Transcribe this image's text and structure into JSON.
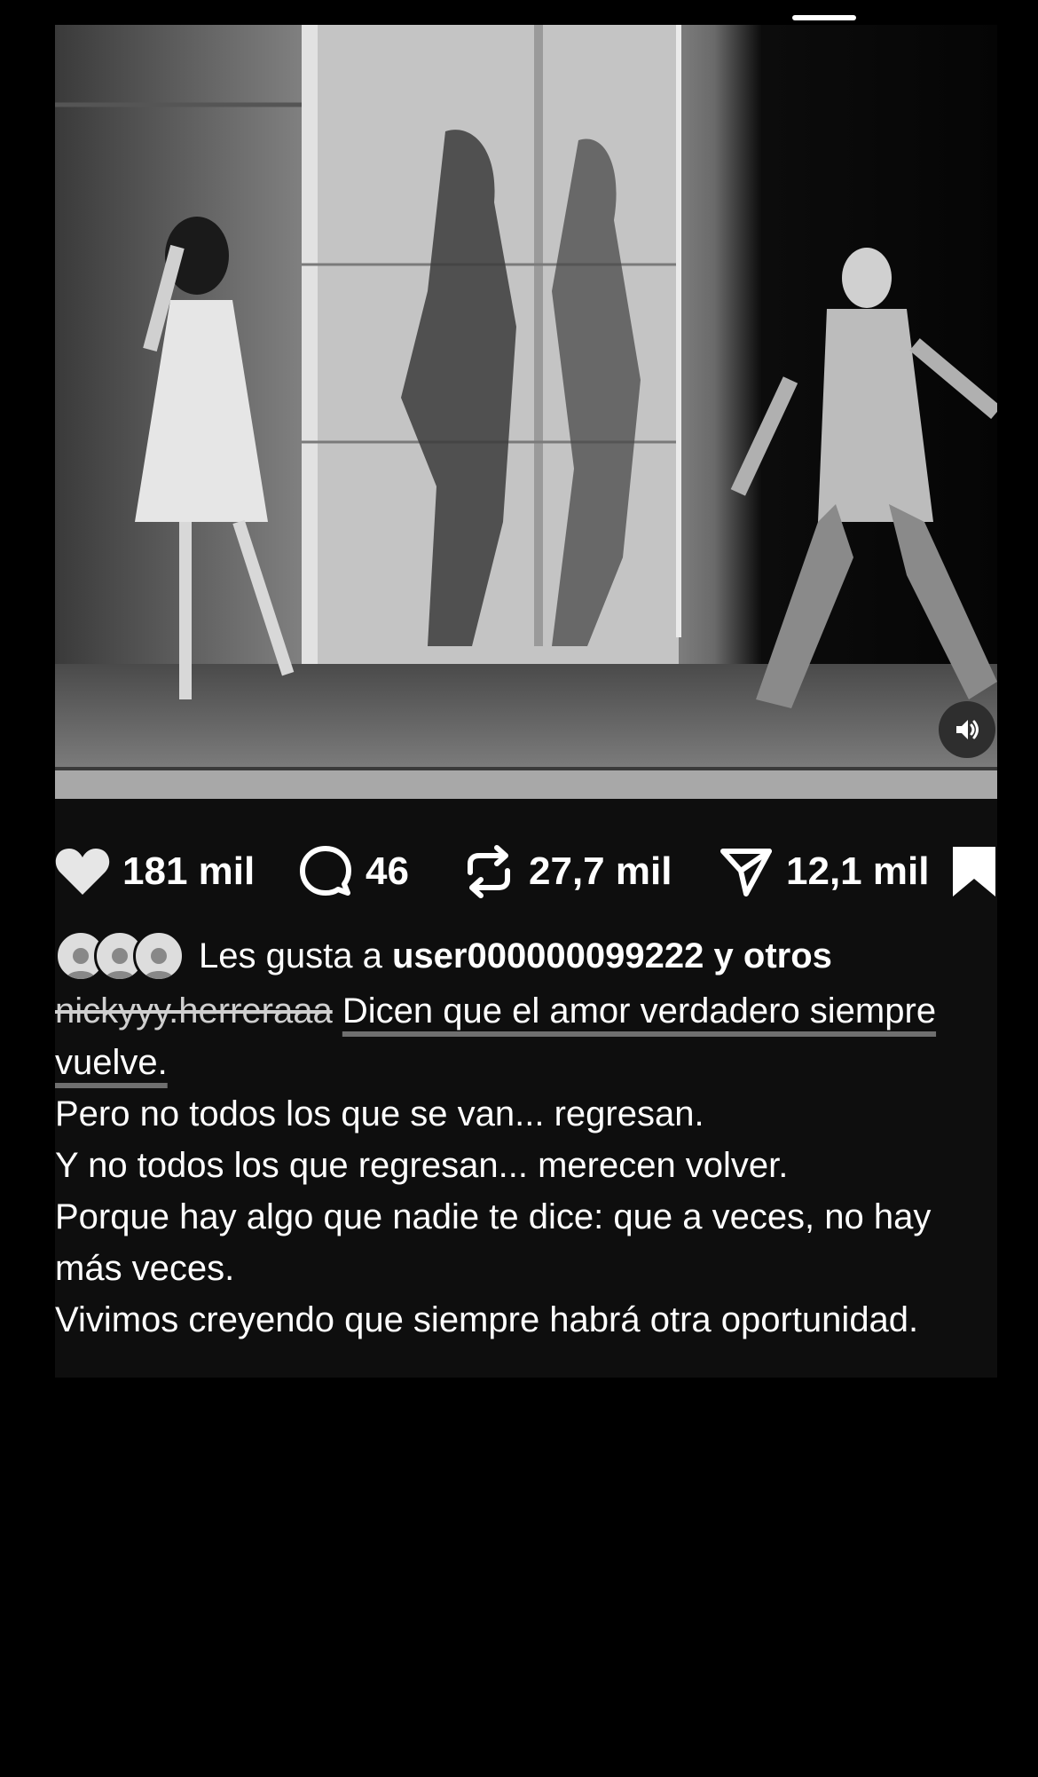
{
  "colors": {
    "background": "#000000",
    "card": "#0e0e0e",
    "text": "#ffffff"
  },
  "media": {
    "description_icon": "video-player",
    "sound_icon": "speaker-on-icon"
  },
  "actions": {
    "like_count": "181 mil",
    "comment_count": "46",
    "repost_count": "27,7 mil",
    "share_count": "12,1 mil"
  },
  "likes": {
    "prefix": "Les gusta a",
    "user": "user000000099222",
    "suffix": "y otros"
  },
  "caption": {
    "username": "nickyyy.herreraaa",
    "first_line": "Dicen que el amor verdadero siempre vuelve.",
    "lines": [
      "Pero no todos los que se van... regresan.",
      "Y no todos los que regresan... merecen volver.",
      "Porque hay algo que nadie te dice: que a veces, no hay más veces.",
      "Vivimos creyendo que siempre habrá otra oportunidad."
    ]
  }
}
